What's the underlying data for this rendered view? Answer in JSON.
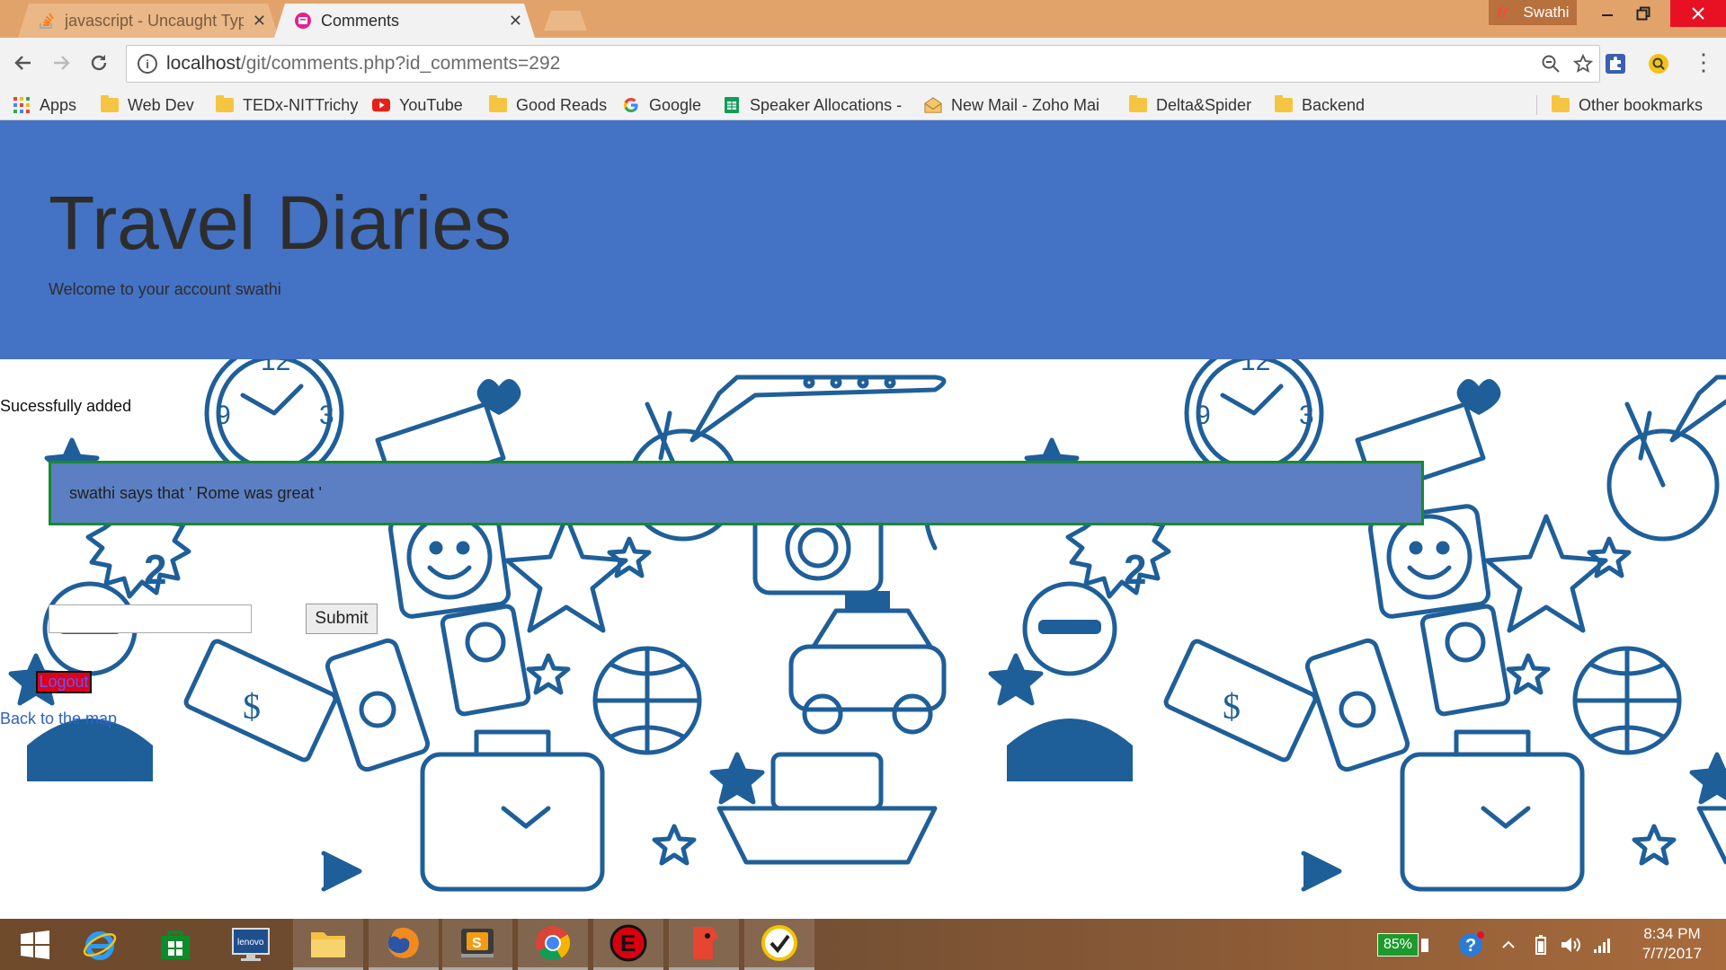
{
  "browser": {
    "tabs": [
      {
        "title": "javascript - Uncaught Typ",
        "active": false,
        "icon": "stackoverflow-icon"
      },
      {
        "title": "Comments",
        "active": true,
        "icon": "page-icon"
      }
    ],
    "profile_name": "Swathi",
    "url_host": "localhost",
    "url_path": "/git/comments.php?id_comments=292",
    "bookmarks": [
      {
        "label": "Apps",
        "icon": "apps-grid-icon"
      },
      {
        "label": "Web Dev",
        "icon": "folder-icon"
      },
      {
        "label": "TEDx-NITTrichy",
        "icon": "folder-icon"
      },
      {
        "label": "YouTube",
        "icon": "youtube-icon"
      },
      {
        "label": "Good Reads",
        "icon": "folder-icon"
      },
      {
        "label": "Google",
        "icon": "google-icon"
      },
      {
        "label": "Speaker Allocations -",
        "icon": "sheets-icon"
      },
      {
        "label": "New Mail - Zoho Mai",
        "icon": "mail-icon"
      },
      {
        "label": "Delta&Spider",
        "icon": "folder-icon"
      },
      {
        "label": "Backend",
        "icon": "folder-icon"
      },
      {
        "label": "Other bookmarks",
        "icon": "folder-icon"
      }
    ]
  },
  "page": {
    "title": "Travel Diaries",
    "subtitle": "Welcome to your account swathi",
    "status": "Sucessfully added",
    "comment": "swathi says that ' Rome was great '",
    "input_value": "",
    "submit_label": "Submit",
    "logout_label": "Logout",
    "back_link": "Back to the map",
    "colors": {
      "header": "#4472c4",
      "comment_bg": "#5b7fc2",
      "comment_border": "#188a2e",
      "logout_bg": "#e0001a"
    }
  },
  "taskbar": {
    "battery": "85%",
    "time": "8:34 PM",
    "date": "7/7/2017",
    "apps": [
      "windows-start-icon",
      "internet-explorer-icon",
      "store-icon",
      "lenovo-icon",
      "file-explorer-icon",
      "firefox-icon",
      "sublime-text-icon",
      "chrome-icon",
      "e-app-icon",
      "red-app-icon",
      "norton-icon"
    ]
  }
}
